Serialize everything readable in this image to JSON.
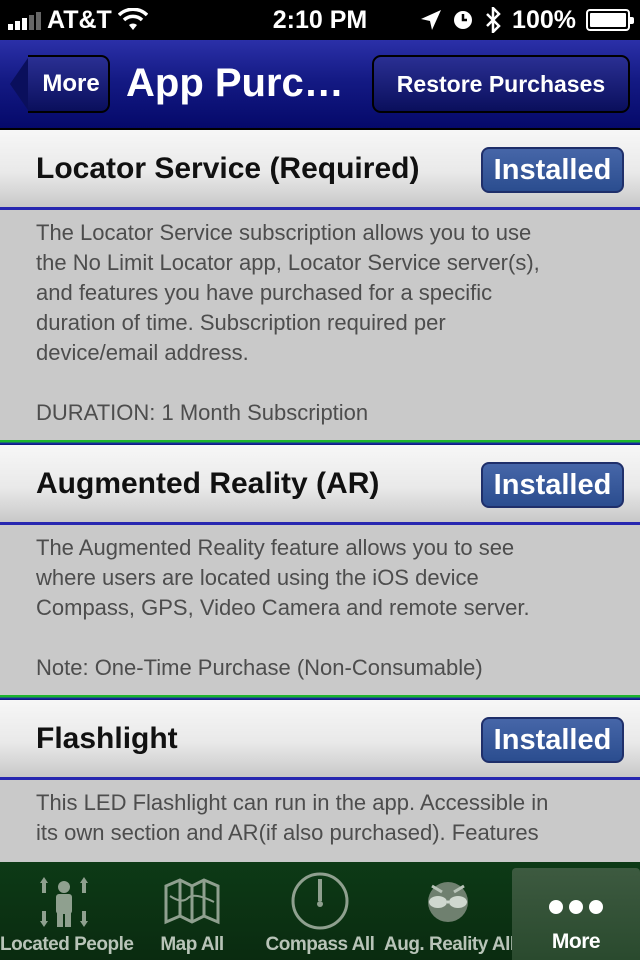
{
  "status_bar": {
    "carrier": "AT&T",
    "time": "2:10 PM",
    "battery": "100%"
  },
  "nav": {
    "back_label": "More",
    "title": "App Purc…",
    "restore_label": "Restore Purchases"
  },
  "items": [
    {
      "title": "Locator Service (Required)",
      "button": "Installed",
      "desc_lines": [
        "The Locator Service subscription allows you to use",
        "the No Limit Locator app, Locator Service server(s),",
        "and features you have purchased for a specific",
        "duration of time.  Subscription required per",
        "device/email address.",
        "",
        "DURATION: 1 Month Subscription"
      ]
    },
    {
      "title": "Augmented Reality (AR)",
      "button": "Installed",
      "desc_lines": [
        "The Augmented Reality feature allows you to see",
        "where users are located using the iOS device",
        "Compass, GPS, Video Camera and remote server.",
        "",
        "Note: One-Time Purchase (Non-Consumable)"
      ]
    },
    {
      "title": "Flashlight",
      "button": "Installed",
      "desc_lines": [
        "This LED Flashlight can run in the app. Accessible in",
        "its own section and AR(if also purchased).  Features"
      ]
    }
  ],
  "tabs": [
    {
      "label": "Located People",
      "icon": "people-icon"
    },
    {
      "label": "Map All",
      "icon": "map-icon"
    },
    {
      "label": "Compass All",
      "icon": "compass-icon"
    },
    {
      "label": "Aug. Reality All",
      "icon": "ar-glasses-icon"
    },
    {
      "label": "More",
      "icon": "more-dots-icon",
      "active": true
    }
  ]
}
